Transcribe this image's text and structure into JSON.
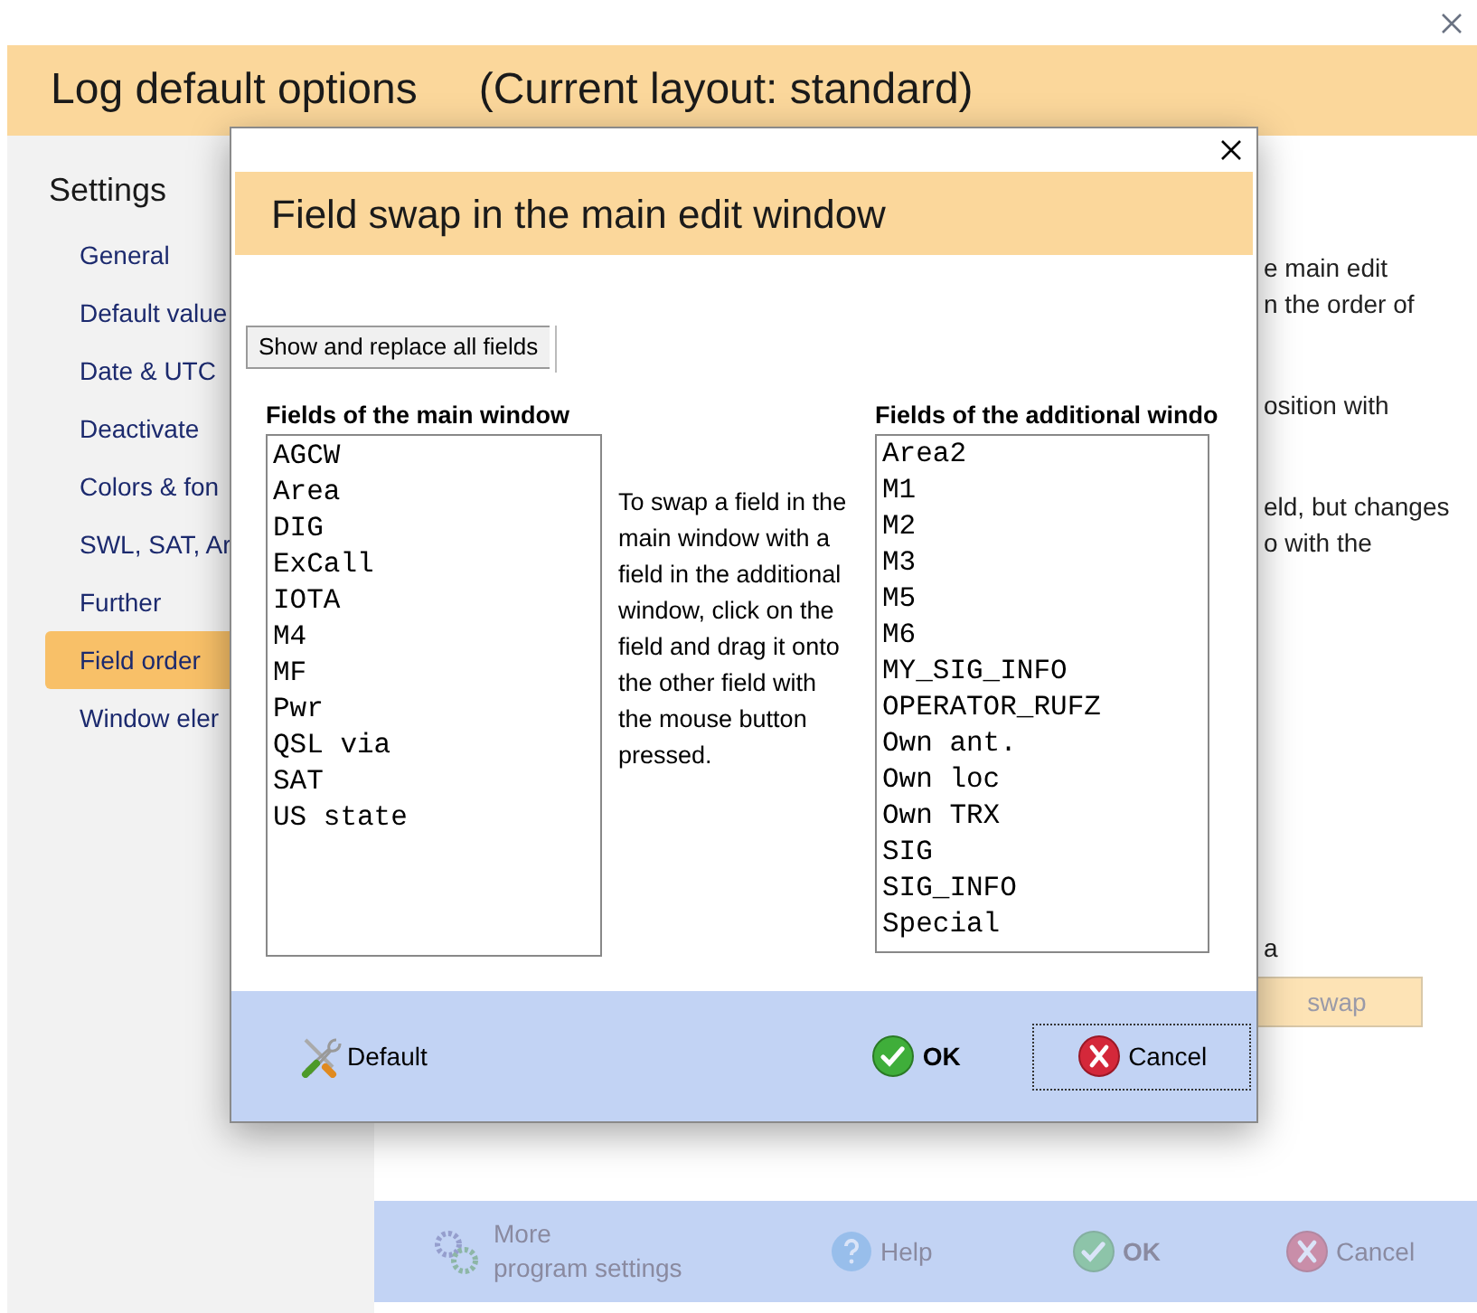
{
  "window": {
    "title": "Log default options",
    "subtitle": "(Current layout: standard)"
  },
  "sidebar": {
    "heading": "Settings",
    "items": [
      {
        "label": "General",
        "selected": false
      },
      {
        "label": "Default value",
        "selected": false
      },
      {
        "label": "Date & UTC",
        "selected": false
      },
      {
        "label": "Deactivate",
        "selected": false
      },
      {
        "label": "Colors & fon",
        "selected": false
      },
      {
        "label": "SWL, SAT, Ar",
        "selected": false
      },
      {
        "label": "Further",
        "selected": false
      },
      {
        "label": "Field order",
        "selected": true
      },
      {
        "label": "Window eler",
        "selected": false
      }
    ]
  },
  "content": {
    "paragraphs": [
      [
        "e main edit",
        "n the order of"
      ],
      [
        "osition with"
      ],
      [
        "eld, but changes",
        "o with the"
      ],
      [
        "a"
      ]
    ],
    "swap_button": "swap"
  },
  "bottom_bar": {
    "more": [
      "More",
      "program settings"
    ],
    "help": "Help",
    "ok": "OK",
    "cancel": "Cancel"
  },
  "dialog": {
    "title": "Field swap in the main edit window",
    "tab": "Show and replace all fields",
    "main_label": "Fields of the main window",
    "main_fields": [
      "AGCW",
      "Area",
      "DIG",
      "ExCall",
      "IOTA",
      "M4",
      "MF",
      "Pwr",
      "QSL via",
      "SAT",
      "US state"
    ],
    "instructions": "To swap a field in the main window with a field in the additional window, click on the field and drag it onto the other field with the mouse button pressed.",
    "additional_label": "Fields of the additional windo",
    "additional_fields": [
      "Area2",
      "M1",
      "M2",
      "M3",
      "M5",
      "M6",
      "MY_SIG_INFO",
      "OPERATOR_RUFZ",
      "Own ant.",
      "Own loc",
      "Own TRX",
      "SIG",
      "SIG_INFO",
      "Special"
    ],
    "default_button": "Default",
    "ok_button": "OK",
    "cancel_button": "Cancel"
  }
}
